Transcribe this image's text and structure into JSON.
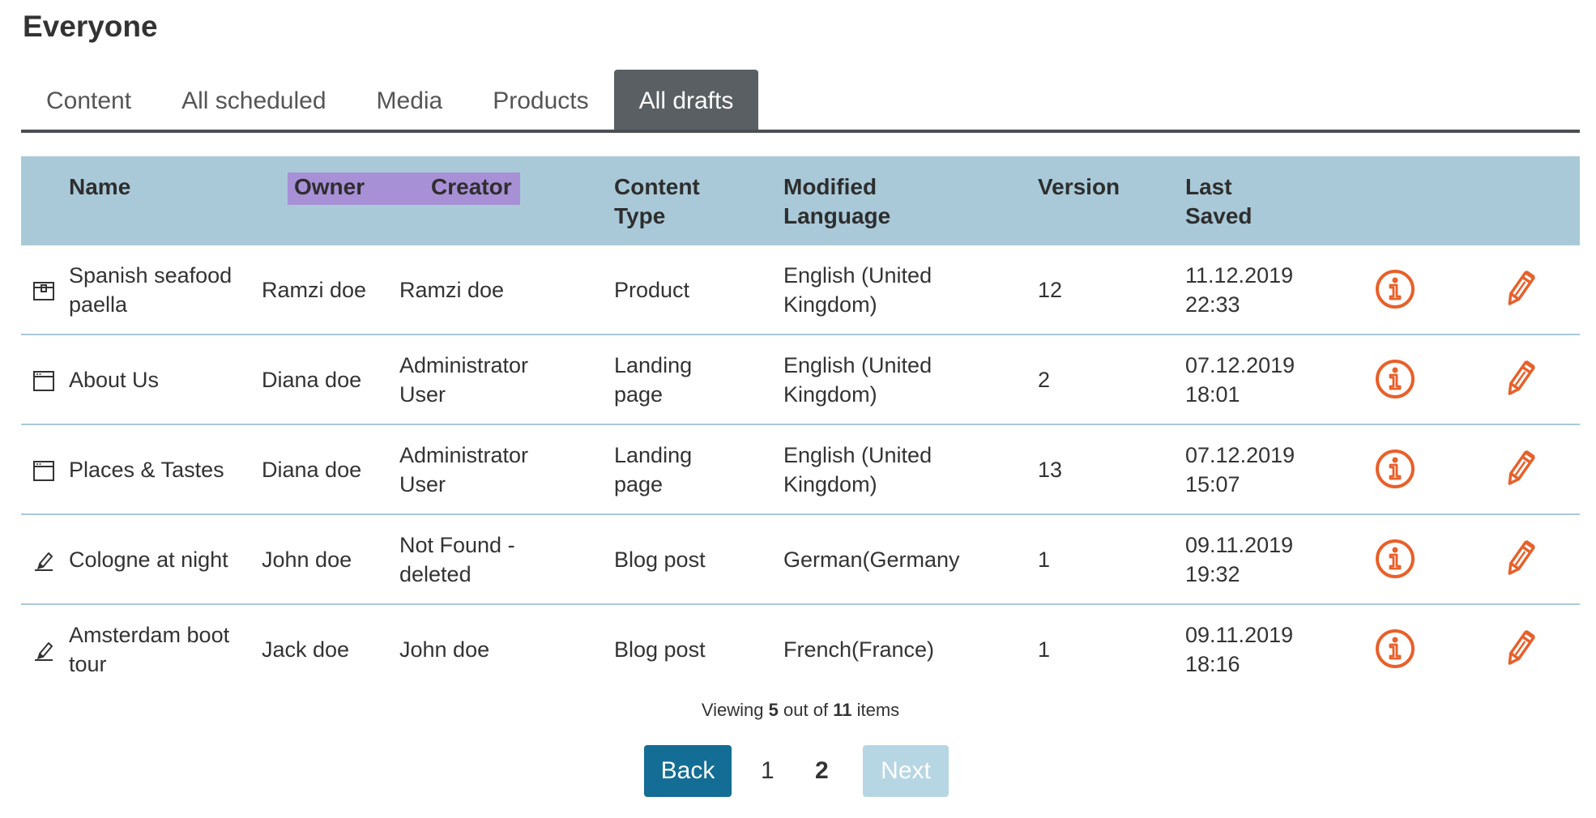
{
  "page_title": "Everyone",
  "tabs": [
    {
      "label": "Content"
    },
    {
      "label": "All scheduled"
    },
    {
      "label": "Media"
    },
    {
      "label": "Products"
    },
    {
      "label": "All drafts"
    }
  ],
  "active_tab": "All drafts",
  "columns": {
    "name": "Name",
    "owner": "Owner",
    "creator": "Creator",
    "content_type_line1": "Content",
    "content_type_line2": "Type",
    "modified_language_line1": "Modified",
    "modified_language_line2": "Language",
    "version": "Version",
    "last_saved_line1": "Last",
    "last_saved_line2": "Saved"
  },
  "rows": [
    {
      "icon": "product-box-icon",
      "name": "Spanish seafood paella",
      "owner": "Ramzi doe",
      "creator": "Ramzi doe",
      "content_type": "Product",
      "language": "English (United Kingdom)",
      "version": "12",
      "date": "11.12.2019",
      "time": "22:33"
    },
    {
      "icon": "landing-page-icon",
      "name": "About Us",
      "owner": "Diana doe",
      "creator": "Administrator User",
      "content_type": "Landing page",
      "language": "English (United Kingdom)",
      "version": "2",
      "date": "07.12.2019",
      "time": "18:01"
    },
    {
      "icon": "landing-page-icon",
      "name": "Places & Tastes",
      "owner": "Diana doe",
      "creator": "Administrator User",
      "content_type": "Landing page",
      "language": "English (United Kingdom)",
      "version": "13",
      "date": "07.12.2019",
      "time": "15:07"
    },
    {
      "icon": "blog-post-pen-icon",
      "name": "Cologne at night",
      "owner": "John doe",
      "creator": "Not Found - deleted",
      "content_type": "Blog post",
      "language": "German(Germany",
      "version": "1",
      "date": "09.11.2019",
      "time": "19:32"
    },
    {
      "icon": "blog-post-pen-icon",
      "name": "Amsterdam boot tour",
      "owner": "Jack doe",
      "creator": "John doe",
      "content_type": "Blog post",
      "language": "French(France)",
      "version": "1",
      "date": "09.11.2019",
      "time": "18:16"
    }
  ],
  "row_actions": {
    "info_icon": "info-icon",
    "edit_icon": "pencil-icon"
  },
  "footer": {
    "viewing_prefix": "Viewing",
    "viewing_count": "5",
    "viewing_middle": "out of",
    "viewing_total": "11",
    "viewing_suffix": "items"
  },
  "pagination": {
    "back_label": "Back",
    "page1": "1",
    "page2": "2",
    "current_page": "2",
    "next_label": "Next"
  },
  "colors": {
    "header_bg": "#a9c9d8",
    "highlight": "#a890d6",
    "active_tab_bg": "#5a5f64",
    "action_orange": "#e8602a",
    "back_button": "#136d94",
    "next_button_disabled": "#b7d6e3"
  }
}
